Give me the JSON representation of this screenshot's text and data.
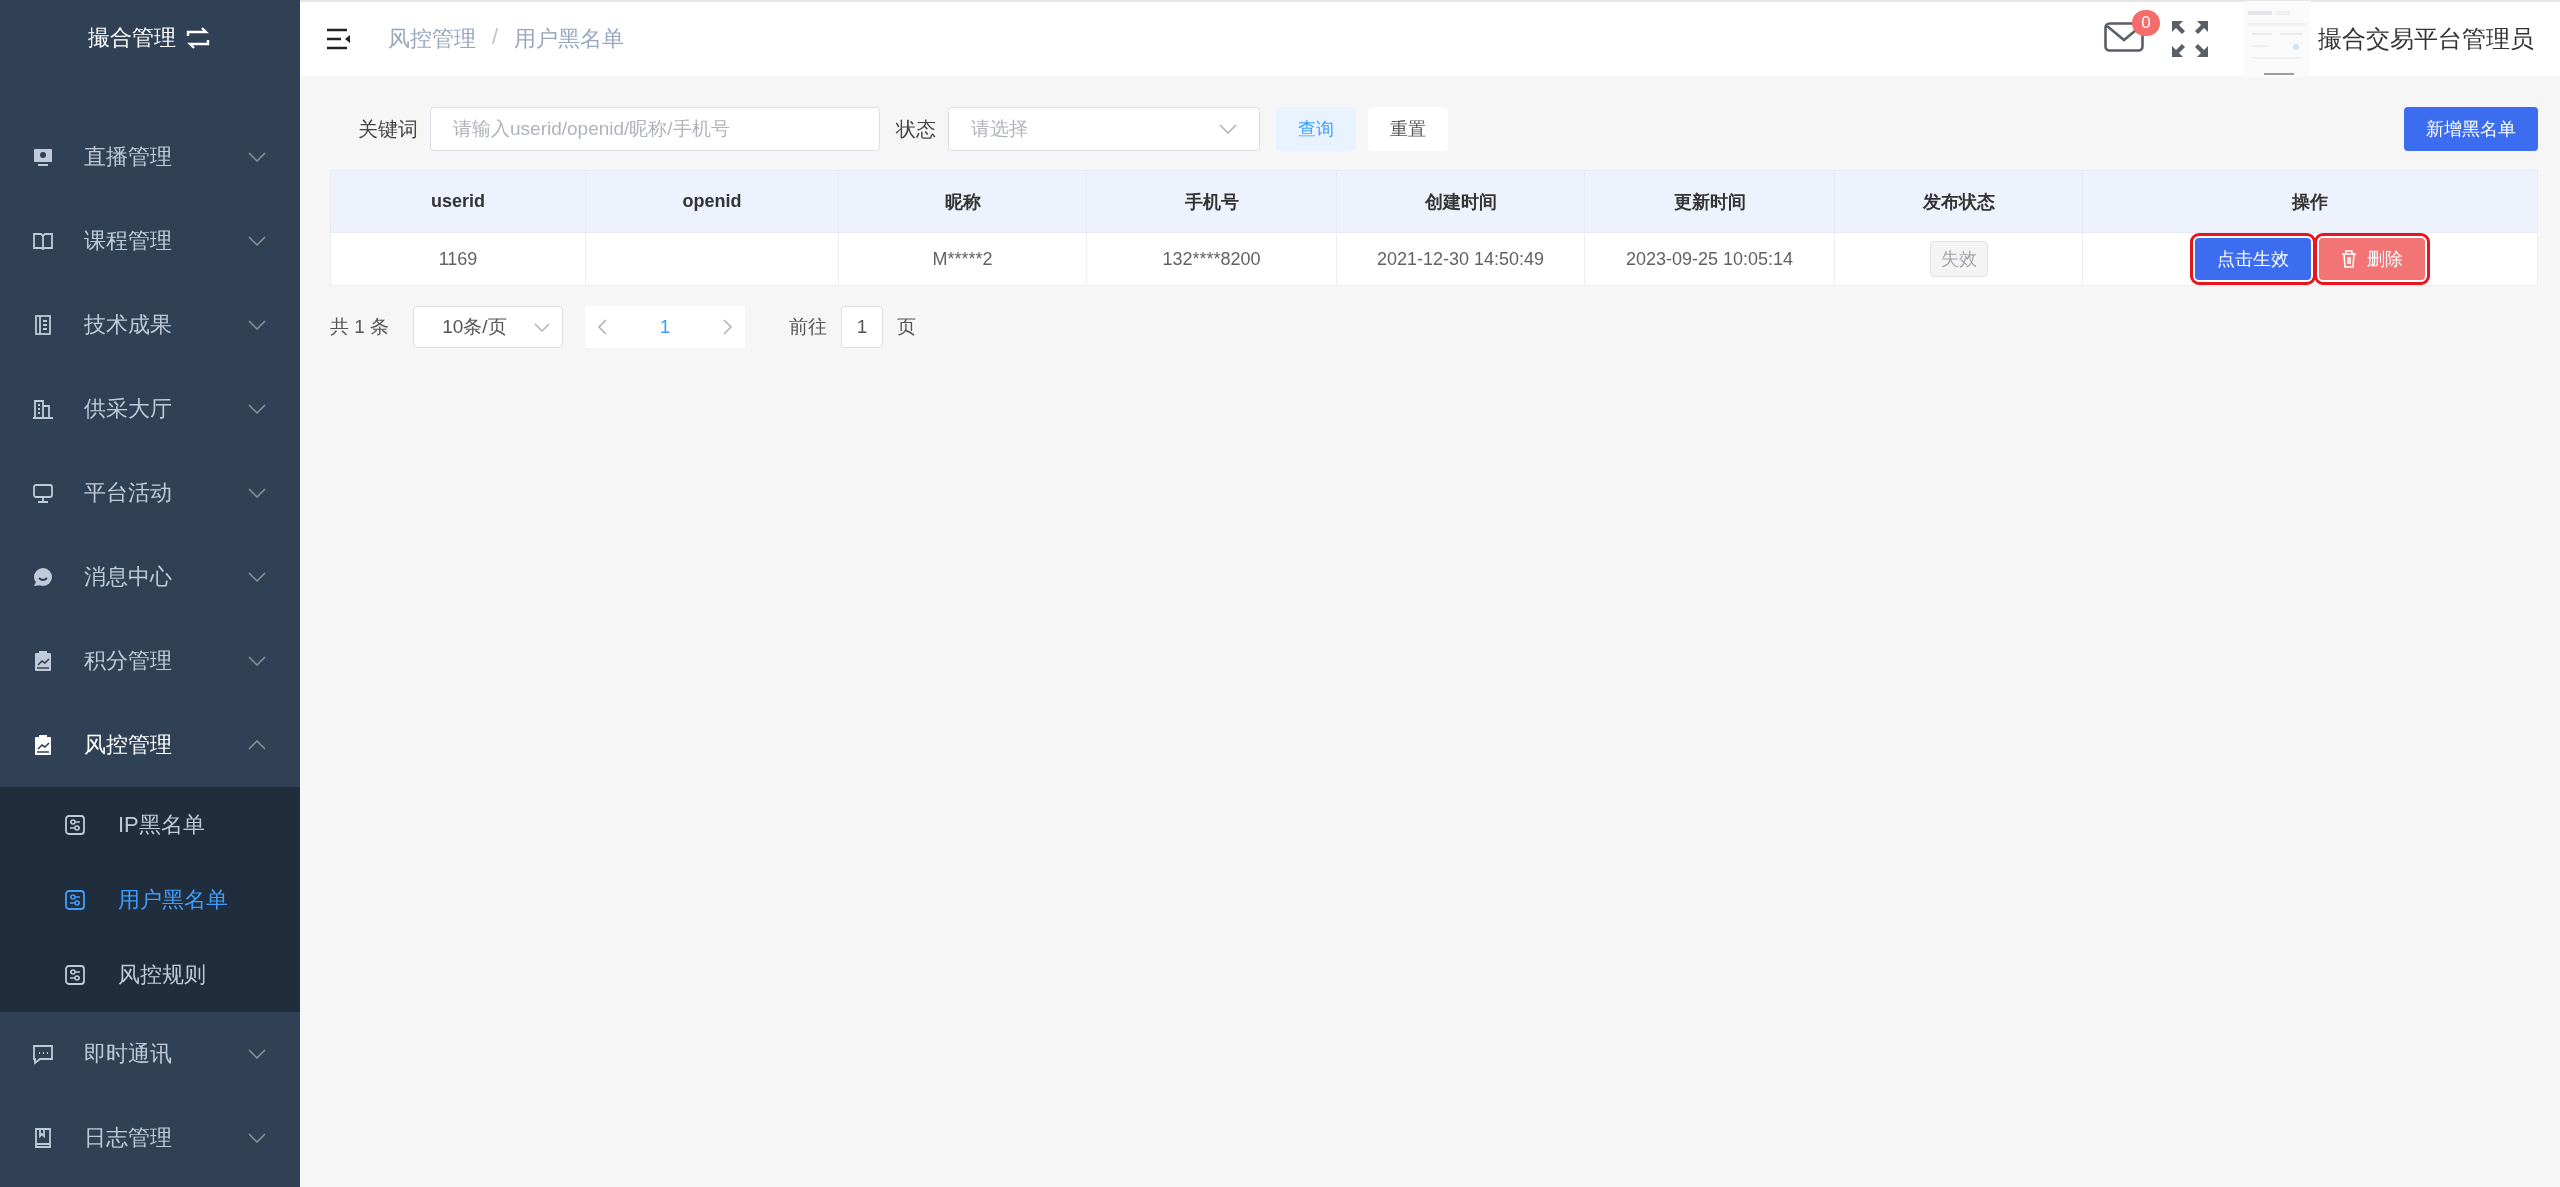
{
  "sidebar": {
    "title": "撮合管理",
    "items": [
      {
        "label": "直播管理",
        "expanded": false
      },
      {
        "label": "课程管理",
        "expanded": false
      },
      {
        "label": "技术成果",
        "expanded": false
      },
      {
        "label": "供采大厅",
        "expanded": false
      },
      {
        "label": "平台活动",
        "expanded": false
      },
      {
        "label": "消息中心",
        "expanded": false
      },
      {
        "label": "积分管理",
        "expanded": false
      },
      {
        "label": "风控管理",
        "expanded": true,
        "children": [
          {
            "label": "IP黑名单",
            "selected": false
          },
          {
            "label": "用户黑名单",
            "selected": true
          },
          {
            "label": "风控规则",
            "selected": false
          }
        ]
      },
      {
        "label": "即时通讯",
        "expanded": false
      },
      {
        "label": "日志管理",
        "expanded": false
      }
    ]
  },
  "header": {
    "breadcrumb": [
      "风控管理",
      "用户黑名单"
    ],
    "separator": "/",
    "notification_count": "0",
    "avatar": {
      "kind": "picture"
    },
    "user_name": "撮合交易平台管理员"
  },
  "filter": {
    "keyword_label": "关键词",
    "keyword_placeholder": "请输入userid/openid/昵称/手机号",
    "status_label": "状态",
    "status_placeholder": "请选择",
    "search_button": "查询",
    "reset_button": "重置",
    "add_button": "新增黑名单"
  },
  "table": {
    "columns": [
      "userid",
      "openid",
      "昵称",
      "手机号",
      "创建时间",
      "更新时间",
      "发布状态",
      "操作"
    ],
    "rows": [
      {
        "userid": "1169",
        "nickname": "M*****2",
        "phone": "132****8200",
        "created": "2021-12-30 14:50:49",
        "updated": "2023-09-25 10:05:14",
        "status": "失效",
        "actions": [
          {
            "label": "点击生效",
            "kind": "enable",
            "highlighted": true
          },
          {
            "label": "删除",
            "kind": "delete",
            "highlighted": true
          }
        ]
      }
    ]
  },
  "pagination": {
    "total": "共 1 条",
    "page_size": "10条/页",
    "page": "1",
    "goto_label": "前往",
    "goto_value": "1",
    "page_unit": "页"
  }
}
